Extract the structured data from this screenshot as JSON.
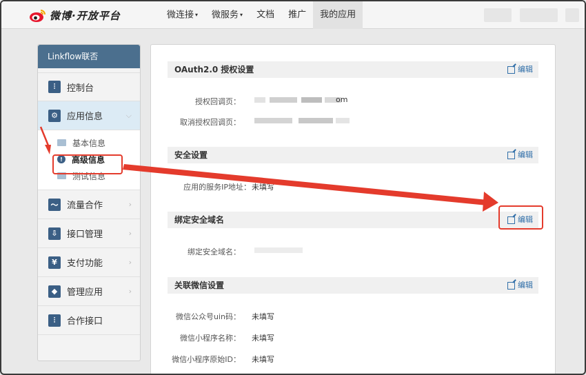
{
  "logo": {
    "text": "微博·开放平台"
  },
  "nav": {
    "items": [
      {
        "label": "微连接",
        "caret": "▾"
      },
      {
        "label": "微服务",
        "caret": "▾"
      },
      {
        "label": "文档",
        "caret": ""
      },
      {
        "label": "推广",
        "caret": ""
      },
      {
        "label": "我的应用",
        "caret": ""
      }
    ]
  },
  "sidebar": {
    "title": "Linkflow联否",
    "items": [
      {
        "label": "控制台",
        "icon": "⫶"
      },
      {
        "label": "应用信息",
        "icon": "⚙"
      },
      {
        "label": "流量合作",
        "icon": "〜"
      },
      {
        "label": "接口管理",
        "icon": "⇩"
      },
      {
        "label": "支付功能",
        "icon": "¥"
      },
      {
        "label": "管理应用",
        "icon": "◆"
      },
      {
        "label": "合作接口",
        "icon": "⫶"
      }
    ],
    "sub": [
      {
        "label": "基本信息"
      },
      {
        "label": "高级信息"
      },
      {
        "label": "测试信息"
      }
    ],
    "chevron_right": "›",
    "chevron_down": "⌵"
  },
  "main": {
    "edit_label": "编辑",
    "sections": [
      {
        "title": "OAuth2.0 授权设置"
      },
      {
        "title": "安全设置"
      },
      {
        "title": "绑定安全域名"
      },
      {
        "title": "关联微信设置"
      }
    ],
    "fields": {
      "auth_callback": {
        "label": "授权回调页：",
        "value_tail": "om"
      },
      "cancel_callback": {
        "label": "取消授权回调页："
      },
      "server_ip": {
        "label": "应用的服务IP地址：",
        "value": "未填写"
      },
      "secure_domain": {
        "label": "绑定安全域名："
      },
      "wechat_uin": {
        "label": "微信公众号uin码：",
        "value": "未填写"
      },
      "mini_name": {
        "label": "微信小程序名称：",
        "value": "未填写"
      },
      "mini_id": {
        "label": "微信小程序原始ID：",
        "value": "未填写"
      }
    }
  },
  "colors": {
    "accent": "#e43b2c",
    "sidebar_title": "#4b6f8e",
    "link": "#2f6ea8"
  }
}
